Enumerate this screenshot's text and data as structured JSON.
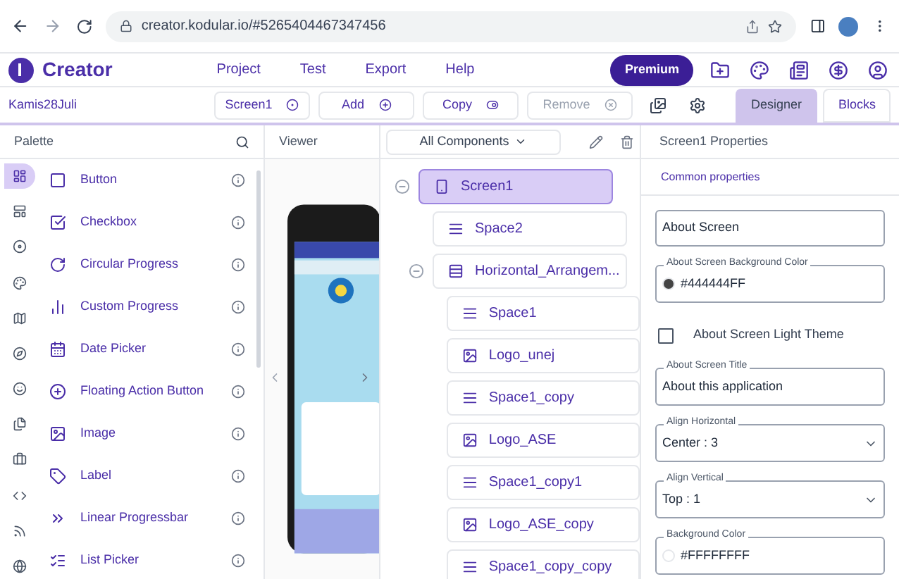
{
  "browser": {
    "url": "creator.kodular.io/#5265404467347456"
  },
  "app": {
    "brand": "Creator",
    "menu": [
      "Project",
      "Test",
      "Export",
      "Help"
    ],
    "premium": "Premium"
  },
  "toolbar": {
    "project": "Kamis28Juli",
    "buttons": [
      {
        "label": "Screen1",
        "kind": "screen",
        "disabled": false
      },
      {
        "label": "Add",
        "kind": "add",
        "disabled": false
      },
      {
        "label": "Copy",
        "kind": "copy",
        "disabled": false
      },
      {
        "label": "Remove",
        "kind": "remove",
        "disabled": true
      }
    ],
    "tabs": [
      {
        "label": "Designer",
        "selected": true
      },
      {
        "label": "Blocks",
        "selected": false
      }
    ]
  },
  "palette": {
    "title": "Palette",
    "rail": [
      {
        "selected": true
      },
      {
        "selected": false
      },
      {
        "selected": false
      },
      {
        "selected": false
      },
      {
        "selected": false
      },
      {
        "selected": false
      },
      {
        "selected": false
      },
      {
        "selected": false
      },
      {
        "selected": false
      },
      {
        "selected": false
      },
      {
        "selected": false
      },
      {
        "selected": false
      }
    ],
    "items": [
      {
        "label": "Button"
      },
      {
        "label": "Checkbox"
      },
      {
        "label": "Circular Progress"
      },
      {
        "label": "Custom Progress"
      },
      {
        "label": "Date Picker"
      },
      {
        "label": "Floating Action Button"
      },
      {
        "label": "Image"
      },
      {
        "label": "Label"
      },
      {
        "label": "Linear Progressbar"
      },
      {
        "label": "List Picker"
      }
    ]
  },
  "viewer": {
    "label": "Viewer"
  },
  "tree": {
    "filter": "All Components",
    "nodes": [
      {
        "label": "Screen1",
        "kind": "screen",
        "selected": true,
        "expanded": true,
        "children": [
          {
            "label": "Space2",
            "kind": "space",
            "selected": false
          },
          {
            "label": "Horizontal_Arrangem...",
            "kind": "arrangement",
            "selected": false,
            "expanded": true,
            "children": [
              {
                "label": "Space1",
                "kind": "space",
                "selected": false
              },
              {
                "label": "Logo_unej",
                "kind": "image",
                "selected": false
              },
              {
                "label": "Space1_copy",
                "kind": "space",
                "selected": false
              },
              {
                "label": "Logo_ASE",
                "kind": "image",
                "selected": false
              },
              {
                "label": "Space1_copy1",
                "kind": "space",
                "selected": false
              },
              {
                "label": "Logo_ASE_copy",
                "kind": "image",
                "selected": false
              },
              {
                "label": "Space1_copy_copy",
                "kind": "space",
                "selected": false
              }
            ]
          }
        ]
      }
    ]
  },
  "properties": {
    "title": "Screen1 Properties",
    "section": "Common properties",
    "fields": [
      {
        "kind": "textarea",
        "value": "About Screen"
      },
      {
        "kind": "color",
        "label": "About Screen Background Color",
        "value": "#444444FF",
        "color": "#444444"
      },
      {
        "kind": "checkbox",
        "label": "About Screen Light Theme",
        "checked": false
      },
      {
        "kind": "text",
        "label": "About Screen Title",
        "value": "About this application"
      },
      {
        "kind": "select",
        "label": "Align Horizontal",
        "value": "Center : 3"
      },
      {
        "kind": "select",
        "label": "Align Vertical",
        "value": "Top : 1"
      },
      {
        "kind": "color",
        "label": "Background Color",
        "value": "#FFFFFFFF",
        "color": "#ffffff"
      }
    ]
  }
}
